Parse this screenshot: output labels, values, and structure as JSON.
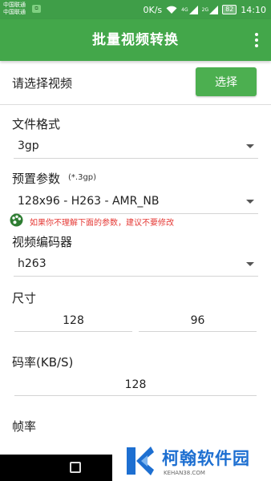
{
  "status_bar": {
    "carrier_line1": "中国联通",
    "carrier_line2": "中国联通",
    "network_speed": "0K/s",
    "signal_label_1": "4G",
    "signal_label_2": "2G",
    "battery": "82",
    "time": "14:10"
  },
  "app_bar": {
    "title": "批量视频转换",
    "menu_icon": "more-vert-icon"
  },
  "select_video": {
    "label": "请选择视频",
    "button_label": "选择"
  },
  "file_format": {
    "label": "文件格式",
    "value": "3gp"
  },
  "preset": {
    "label": "预置参数",
    "hint": "(*.3gp)",
    "value": "128x96 - H263 - AMR_NB"
  },
  "warning": {
    "icon": "palette-icon",
    "text": "如果你不理解下面的参数，建议不要修改"
  },
  "video_encoder": {
    "label": "视频编码器",
    "value": "h263"
  },
  "size": {
    "label": "尺寸",
    "width": "128",
    "height": "96"
  },
  "bitrate": {
    "label": "码率(KB/S)",
    "value": "128"
  },
  "frame_rate": {
    "label": "帧率"
  },
  "watermark": {
    "name": "柯翰软件园",
    "domain": "KEHAN38.COM"
  },
  "colors": {
    "status_bar": "#3f9e48",
    "app_bar": "#43a74a",
    "button": "#4caf50",
    "warning_text": "#e53935",
    "watermark_blue": "#1d6fd1"
  }
}
